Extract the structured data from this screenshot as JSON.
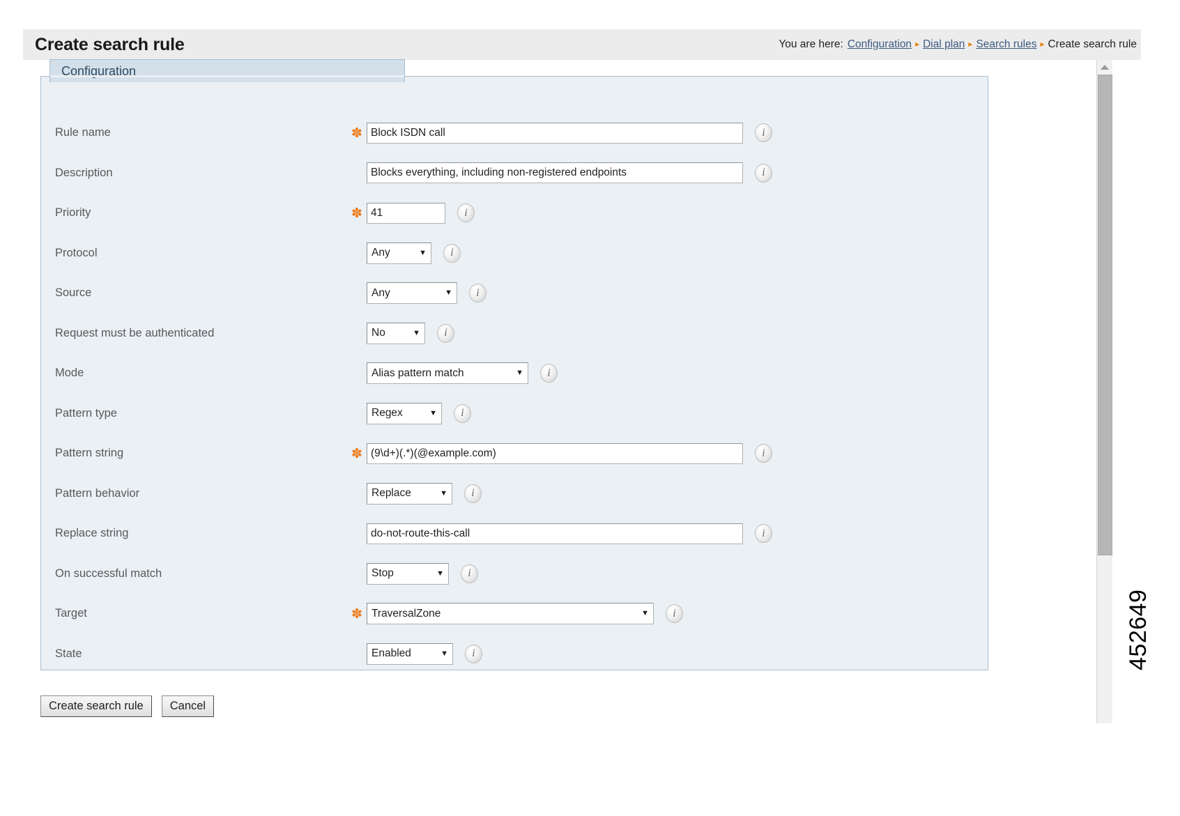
{
  "header": {
    "title": "Create search rule",
    "breadcrumb": {
      "prefix": "You are here:",
      "separator": "▸",
      "items": [
        {
          "label": "Configuration",
          "link": true
        },
        {
          "label": "Dial plan",
          "link": true
        },
        {
          "label": "Search rules",
          "link": true
        },
        {
          "label": "Create search rule",
          "link": false
        }
      ]
    }
  },
  "panel": {
    "legend": "Configuration"
  },
  "fields": [
    {
      "label": "Rule name",
      "required": true,
      "control": "text",
      "width": "wide",
      "value": "Block ISDN call",
      "info": "i"
    },
    {
      "label": "Description",
      "required": false,
      "control": "text",
      "width": "wide",
      "value": "Blocks everything, including non-registered endpoints",
      "info": "i"
    },
    {
      "label": "Priority",
      "required": true,
      "control": "text",
      "width": "narrow",
      "value": "41",
      "info": "i"
    },
    {
      "label": "Protocol",
      "required": false,
      "control": "select",
      "width": "any",
      "value": "Any",
      "info": "i"
    },
    {
      "label": "Source",
      "required": false,
      "control": "select",
      "width": "source",
      "value": "Any",
      "info": "i"
    },
    {
      "label": "Request must be authenticated",
      "required": false,
      "control": "select",
      "width": "no",
      "value": "No",
      "info": "i"
    },
    {
      "label": "Mode",
      "required": false,
      "control": "select",
      "width": "mode",
      "value": "Alias pattern match",
      "info": "i"
    },
    {
      "label": "Pattern type",
      "required": false,
      "control": "select",
      "width": "regex",
      "value": "Regex",
      "info": "i"
    },
    {
      "label": "Pattern string",
      "required": true,
      "control": "text",
      "width": "wide",
      "value": "(9\\d+)(.*)(@example.com)",
      "info": "i"
    },
    {
      "label": "Pattern behavior",
      "required": false,
      "control": "select",
      "width": "behav",
      "value": "Replace",
      "info": "i"
    },
    {
      "label": "Replace string",
      "required": false,
      "control": "text",
      "width": "wide",
      "value": "do-not-route-this-call",
      "info": "i"
    },
    {
      "label": "On successful match",
      "required": false,
      "control": "select",
      "width": "stop",
      "value": "Stop",
      "info": "i"
    },
    {
      "label": "Target",
      "required": true,
      "control": "select",
      "width": "target",
      "value": "TraversalZone",
      "info": "i"
    },
    {
      "label": "State",
      "required": false,
      "control": "select",
      "width": "state",
      "value": "Enabled",
      "info": "i"
    }
  ],
  "buttons": {
    "submit": "Create search rule",
    "cancel": "Cancel"
  },
  "figure_number": "452649",
  "colors": {
    "accent_orange": "#f07c1a",
    "link_blue": "#3d5a80",
    "panel_bg": "#eaf0f4",
    "legend_bg": "#d3dfe9",
    "header_bg": "#ececed"
  },
  "select_caret": "▼"
}
